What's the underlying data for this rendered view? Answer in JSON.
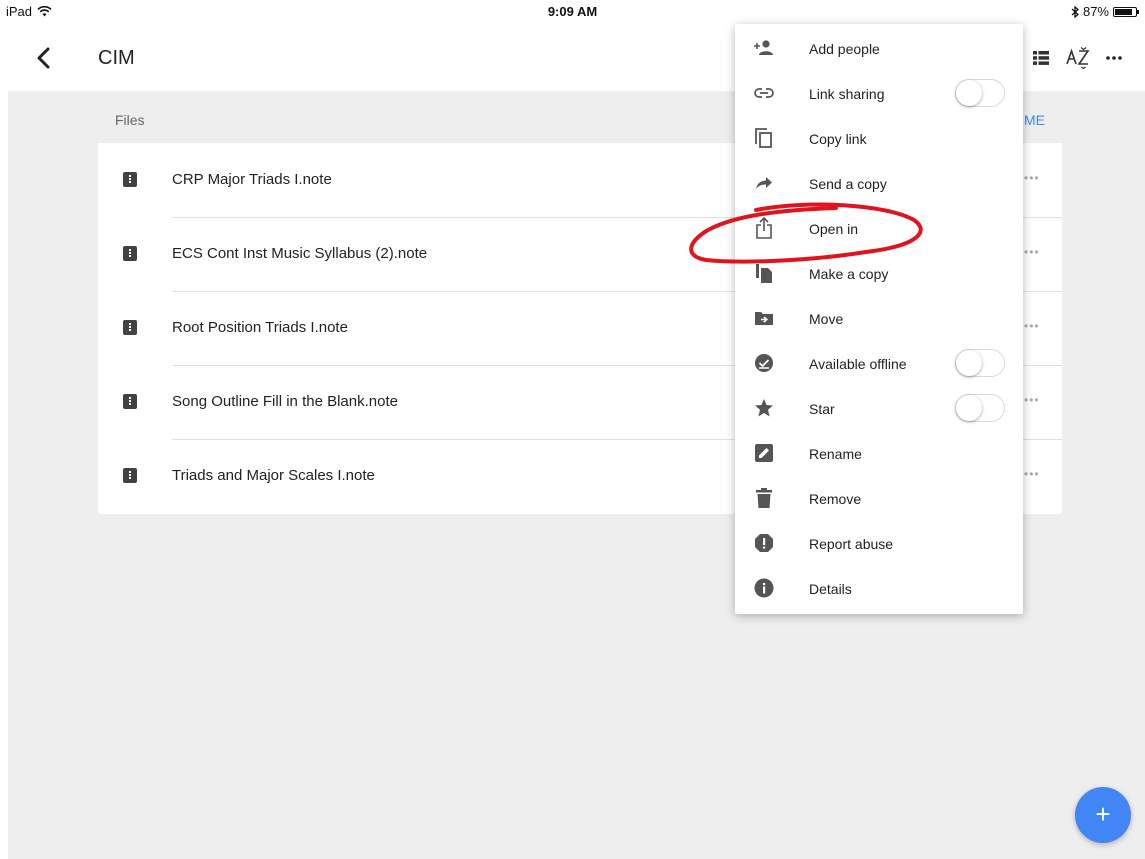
{
  "status_bar": {
    "device": "iPad",
    "time": "9:09 AM",
    "battery": "87%",
    "battery_level": 0.87
  },
  "header": {
    "title": "CIM"
  },
  "files_section": {
    "label": "Files",
    "sort_label": "ME"
  },
  "files": [
    {
      "name": "CRP Major Triads I.note",
      "more": "•••"
    },
    {
      "name": "ECS Cont Inst Music Syllabus (2).note",
      "more": "•••"
    },
    {
      "name": "Root Position Triads I.note",
      "more": "•••"
    },
    {
      "name": "Song Outline Fill in the Blank.note",
      "more": "•••"
    },
    {
      "name": "Triads and Major Scales I.note",
      "more": "•••"
    }
  ],
  "menu": {
    "add_people": "Add people",
    "link_sharing": "Link sharing",
    "copy_link": "Copy link",
    "send_copy": "Send a copy",
    "open_in": "Open in",
    "make_copy": "Make a copy",
    "move": "Move",
    "available_offline": "Available offline",
    "star": "Star",
    "rename": "Rename",
    "remove": "Remove",
    "report_abuse": "Report abuse",
    "details": "Details"
  },
  "fab": {
    "label": "+"
  },
  "colors": {
    "accent": "#4285f4",
    "annotation": "#e0141e",
    "background": "#eeeeee"
  },
  "icons": [
    "wifi-icon",
    "bluetooth-icon",
    "battery-icon",
    "back-chevron-icon",
    "list-view-icon",
    "sort-az-icon",
    "more-horiz-icon",
    "note-file-icon",
    "add-person-icon",
    "link-icon",
    "copy-icon",
    "send-arrow-icon",
    "share-open-icon",
    "make-copy-icon",
    "move-folder-icon",
    "offline-check-icon",
    "star-icon",
    "rename-pencil-icon",
    "trash-icon",
    "report-icon",
    "info-icon"
  ]
}
